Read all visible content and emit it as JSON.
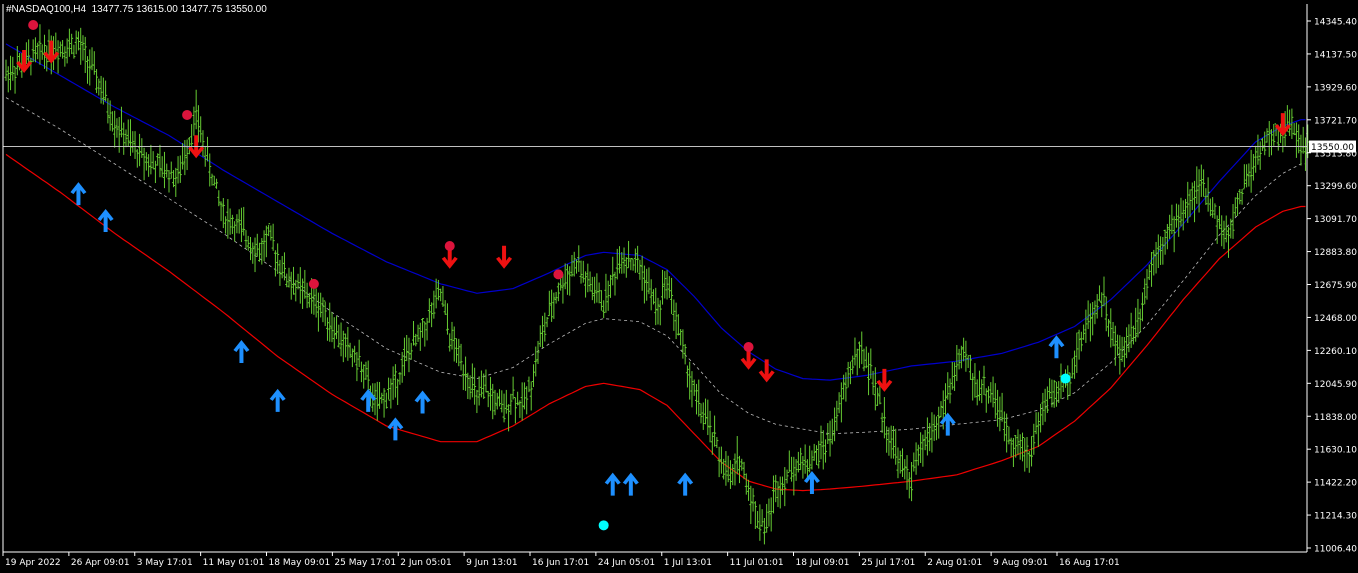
{
  "header": {
    "symbol_timeframe": "#NASDAQ100,H4",
    "ohlc": "13477.75 13615.00 13477.75 13550.00"
  },
  "chart_data": {
    "type": "bar",
    "symbol": "#NASDAQ100",
    "timeframe": "H4",
    "current_price": 13550.0,
    "current_price_label": "13550.00",
    "y_axis": {
      "ylim": [
        11006.4,
        14345.4
      ],
      "ticks": [
        "14345.40",
        "14137.50",
        "13929.60",
        "13721.70",
        "13513.80",
        "13299.60",
        "13091.70",
        "12883.80",
        "12675.90",
        "12468.00",
        "12260.10",
        "12045.90",
        "11838.00",
        "11630.10",
        "11422.20",
        "11214.30",
        "11006.40"
      ]
    },
    "x_axis": {
      "ticks": [
        "19 Apr 2022",
        "26 Apr 09:01",
        "3 May 17:01",
        "11 May 01:01",
        "18 May 09:01",
        "25 May 17:01",
        "2 Jun 05:01",
        "9 Jun 13:01",
        "16 Jun 17:01",
        "24 Jun 05:01",
        "1 Jul 13:01",
        "11 Jul 01:01",
        "18 Jul 09:01",
        "25 Jul 17:01",
        "2 Aug 01:01",
        "9 Aug 09:01",
        "16 Aug 17:01"
      ]
    },
    "price_path": [
      [
        0,
        14010
      ],
      [
        4,
        14160
      ],
      [
        8,
        14200
      ],
      [
        10,
        13980
      ],
      [
        12,
        13700
      ],
      [
        14,
        13550
      ],
      [
        16,
        13450
      ],
      [
        19,
        13350
      ],
      [
        21,
        13750
      ],
      [
        22,
        13520
      ],
      [
        24,
        13120
      ],
      [
        26,
        13020
      ],
      [
        28,
        12880
      ],
      [
        29,
        12980
      ],
      [
        31,
        12720
      ],
      [
        33,
        12620
      ],
      [
        35,
        12520
      ],
      [
        37,
        12320
      ],
      [
        39,
        12180
      ],
      [
        41,
        11900
      ],
      [
        43,
        12050
      ],
      [
        44,
        12200
      ],
      [
        46,
        12380
      ],
      [
        47,
        12500
      ],
      [
        48,
        12620
      ],
      [
        49,
        12350
      ],
      [
        51,
        12100
      ],
      [
        52,
        11950
      ],
      [
        53,
        12000
      ],
      [
        55,
        11870
      ],
      [
        56,
        11980
      ],
      [
        57,
        11900
      ],
      [
        58,
        12050
      ],
      [
        59,
        12320
      ],
      [
        61,
        12650
      ],
      [
        63,
        12820
      ],
      [
        64,
        12700
      ],
      [
        66,
        12560
      ],
      [
        68,
        12860
      ],
      [
        70,
        12790
      ],
      [
        71,
        12650
      ],
      [
        72,
        12500
      ],
      [
        73,
        12720
      ],
      [
        75,
        12200
      ],
      [
        76,
        11980
      ],
      [
        78,
        11720
      ],
      [
        79,
        11560
      ],
      [
        80,
        11430
      ],
      [
        81,
        11580
      ],
      [
        82,
        11380
      ],
      [
        83,
        11200
      ],
      [
        84,
        11150
      ],
      [
        85,
        11380
      ],
      [
        87,
        11520
      ],
      [
        89,
        11560
      ],
      [
        91,
        11700
      ],
      [
        92,
        11880
      ],
      [
        93,
        12100
      ],
      [
        94,
        12250
      ],
      [
        95,
        12200
      ],
      [
        96,
        12020
      ],
      [
        97,
        11800
      ],
      [
        98,
        11650
      ],
      [
        99,
        11500
      ],
      [
        100,
        11450
      ],
      [
        101,
        11620
      ],
      [
        103,
        11820
      ],
      [
        104,
        11980
      ],
      [
        105,
        12160
      ],
      [
        106,
        12220
      ],
      [
        107,
        12050
      ],
      [
        109,
        11980
      ],
      [
        110,
        11820
      ],
      [
        111,
        11700
      ],
      [
        113,
        11600
      ],
      [
        114,
        11800
      ],
      [
        115,
        11950
      ],
      [
        117,
        12050
      ],
      [
        118,
        12200
      ],
      [
        119,
        12380
      ],
      [
        120,
        12500
      ],
      [
        121,
        12620
      ],
      [
        122,
        12380
      ],
      [
        123,
        12220
      ],
      [
        125,
        12460
      ],
      [
        126,
        12700
      ],
      [
        127,
        12900
      ],
      [
        129,
        13050
      ],
      [
        131,
        13230
      ],
      [
        132,
        13300
      ],
      [
        133,
        13200
      ],
      [
        134,
        13050
      ],
      [
        135,
        12960
      ],
      [
        136,
        13200
      ],
      [
        138,
        13480
      ],
      [
        139,
        13580
      ],
      [
        141,
        13640
      ],
      [
        142,
        13700
      ],
      [
        143,
        13570
      ]
    ],
    "upper_band": [
      [
        0,
        14200
      ],
      [
        6,
        14000
      ],
      [
        12,
        13800
      ],
      [
        18,
        13620
      ],
      [
        24,
        13400
      ],
      [
        30,
        13200
      ],
      [
        36,
        13000
      ],
      [
        42,
        12820
      ],
      [
        48,
        12680
      ],
      [
        52,
        12620
      ],
      [
        56,
        12650
      ],
      [
        60,
        12750
      ],
      [
        64,
        12860
      ],
      [
        66,
        12880
      ],
      [
        70,
        12860
      ],
      [
        73,
        12770
      ],
      [
        76,
        12600
      ],
      [
        79,
        12400
      ],
      [
        82,
        12250
      ],
      [
        85,
        12140
      ],
      [
        88,
        12080
      ],
      [
        91,
        12070
      ],
      [
        95,
        12100
      ],
      [
        100,
        12160
      ],
      [
        105,
        12190
      ],
      [
        110,
        12240
      ],
      [
        114,
        12310
      ],
      [
        118,
        12410
      ],
      [
        122,
        12580
      ],
      [
        126,
        12800
      ],
      [
        130,
        13060
      ],
      [
        134,
        13330
      ],
      [
        138,
        13580
      ],
      [
        141,
        13680
      ],
      [
        143,
        13720
      ]
    ],
    "middle_band": [
      [
        0,
        13860
      ],
      [
        6,
        13660
      ],
      [
        12,
        13440
      ],
      [
        18,
        13220
      ],
      [
        24,
        13000
      ],
      [
        30,
        12760
      ],
      [
        36,
        12500
      ],
      [
        42,
        12270
      ],
      [
        48,
        12120
      ],
      [
        52,
        12080
      ],
      [
        56,
        12150
      ],
      [
        60,
        12300
      ],
      [
        64,
        12430
      ],
      [
        66,
        12460
      ],
      [
        70,
        12440
      ],
      [
        73,
        12350
      ],
      [
        76,
        12170
      ],
      [
        79,
        11980
      ],
      [
        82,
        11860
      ],
      [
        85,
        11790
      ],
      [
        88,
        11760
      ],
      [
        91,
        11730
      ],
      [
        95,
        11740
      ],
      [
        100,
        11760
      ],
      [
        105,
        11790
      ],
      [
        110,
        11820
      ],
      [
        114,
        11880
      ],
      [
        118,
        11990
      ],
      [
        122,
        12180
      ],
      [
        126,
        12420
      ],
      [
        130,
        12700
      ],
      [
        134,
        12990
      ],
      [
        138,
        13240
      ],
      [
        141,
        13380
      ],
      [
        143,
        13440
      ]
    ],
    "lower_band": [
      [
        0,
        13500
      ],
      [
        6,
        13260
      ],
      [
        12,
        13000
      ],
      [
        18,
        12760
      ],
      [
        24,
        12500
      ],
      [
        30,
        12220
      ],
      [
        36,
        11980
      ],
      [
        42,
        11780
      ],
      [
        48,
        11680
      ],
      [
        52,
        11680
      ],
      [
        56,
        11780
      ],
      [
        60,
        11920
      ],
      [
        64,
        12030
      ],
      [
        66,
        12050
      ],
      [
        70,
        12010
      ],
      [
        73,
        11910
      ],
      [
        76,
        11730
      ],
      [
        79,
        11550
      ],
      [
        82,
        11430
      ],
      [
        85,
        11380
      ],
      [
        88,
        11370
      ],
      [
        91,
        11380
      ],
      [
        95,
        11400
      ],
      [
        100,
        11430
      ],
      [
        105,
        11470
      ],
      [
        110,
        11560
      ],
      [
        114,
        11650
      ],
      [
        118,
        11810
      ],
      [
        122,
        12020
      ],
      [
        126,
        12290
      ],
      [
        130,
        12580
      ],
      [
        134,
        12840
      ],
      [
        138,
        13040
      ],
      [
        141,
        13140
      ],
      [
        143,
        13170
      ]
    ],
    "sell_arrows": [
      [
        2,
        14060
      ],
      [
        5,
        14120
      ],
      [
        21,
        13520
      ],
      [
        49,
        12820
      ],
      [
        55,
        12820
      ],
      [
        82,
        12180
      ],
      [
        84,
        12100
      ],
      [
        97,
        12040
      ],
      [
        141,
        13660
      ]
    ],
    "buy_arrows": [
      [
        8,
        13280
      ],
      [
        11,
        13110
      ],
      [
        26,
        12280
      ],
      [
        30,
        11970
      ],
      [
        40,
        11970
      ],
      [
        43,
        11790
      ],
      [
        46,
        11960
      ],
      [
        67,
        11440
      ],
      [
        69,
        11440
      ],
      [
        75,
        11440
      ],
      [
        89,
        11450
      ],
      [
        104,
        11820
      ],
      [
        116,
        12310
      ]
    ],
    "red_dots": [
      [
        3,
        14320
      ],
      [
        20,
        13750
      ],
      [
        34,
        12680
      ],
      [
        49,
        12920
      ],
      [
        61,
        12740
      ],
      [
        82,
        12280
      ]
    ],
    "cyan_dots": [
      [
        66,
        11150
      ],
      [
        117,
        12080
      ]
    ],
    "colors": {
      "bull_bar": "#66cc33",
      "upper_band": "#0000cc",
      "middle_band": "#bbbbbb",
      "lower_band": "#ee0000",
      "sell_arrow": "#ee1111",
      "buy_arrow": "#1e90ff",
      "red_dot": "#dc143c",
      "cyan_dot": "#00ffff",
      "axis": "#ffffff",
      "background": "#000000"
    }
  }
}
